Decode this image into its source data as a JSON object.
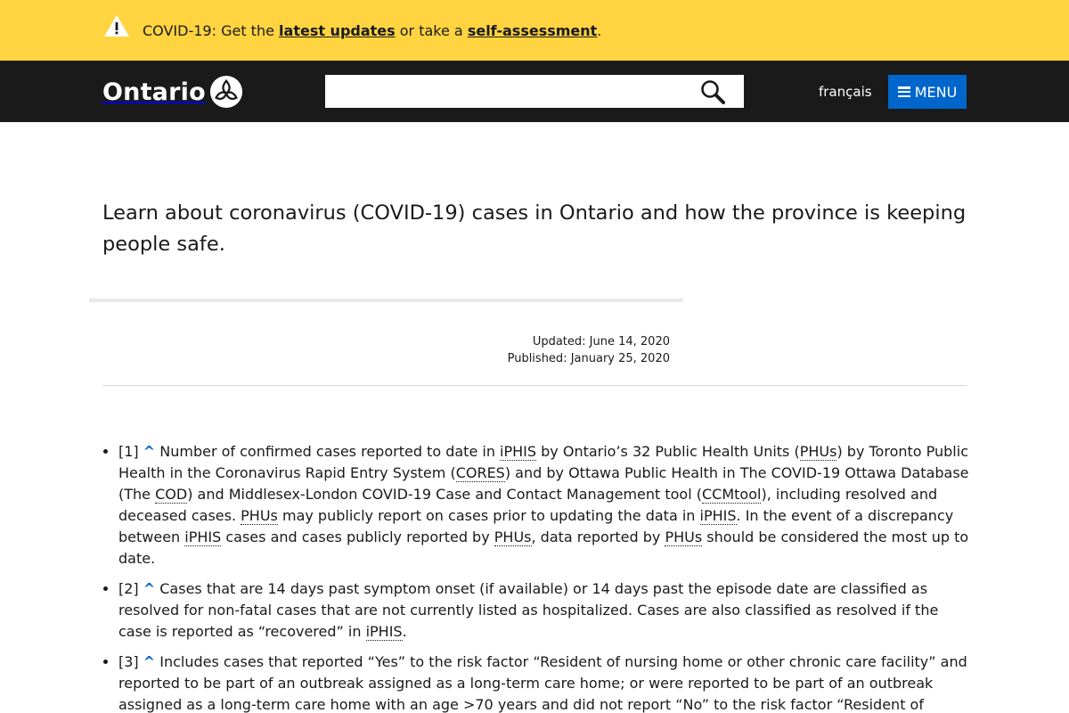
{
  "alert": {
    "icon": "warning-triangle-icon",
    "prefix": "COVID-19: Get the ",
    "link1": "latest updates",
    "middle": " or take a ",
    "link2": "self-assessment",
    "suffix": "."
  },
  "header": {
    "logo_text": "Ontario",
    "logo_icon": "trillium-icon",
    "search_placeholder": "",
    "search_icon": "magnifier-icon",
    "language_link": "français",
    "menu_label": "MENU",
    "menu_icon": "hamburger-icon"
  },
  "main": {
    "lead": "Learn about coronavirus (COVID-19) cases in Ontario and how the province is keeping people safe.",
    "updated": "Updated: June 14, 2020",
    "published": "Published: January 25, 2020"
  },
  "footnotes": {
    "caret": "^",
    "items": [
      {
        "ref": "[1]",
        "t1": " Number of confirmed cases reported to date in ",
        "a1": "iPHIS",
        "t2": " by Ontario’s 32 Public Health Units (",
        "a2": "PHUs",
        "t3": ") by Toronto Public Health in the Coronavirus Rapid Entry System (",
        "a3": "CORES",
        "t4": ") and by Ottawa Public Health in The COVID-19 Ottawa Database (The ",
        "a4": "COD",
        "t5": ") and Middlesex-London COVID-19 Case and Contact Management tool (",
        "a5": "CCMtool",
        "t6": "), including resolved and deceased cases. ",
        "a6": "PHUs",
        "t7": " may publicly report on cases prior to updating the data in ",
        "a7": "iPHIS",
        "t8": ". In the event of a discrepancy between ",
        "a8": "iPHIS",
        "t9": " cases and cases publicly reported by ",
        "a9": "PHUs",
        "t10": ", data reported by ",
        "a10": "PHUs",
        "t11": " should be considered the most up to date."
      },
      {
        "ref": "[2]",
        "t1": " Cases that are 14 days past symptom onset (if available) or 14 days past the episode date are classified as resolved for non-fatal cases that are not currently listed as hospitalized. Cases are also classified as resolved if the case is reported as “recovered” in ",
        "a1": "iPHIS",
        "t2": "."
      },
      {
        "ref": "[3]",
        "t1": " Includes cases that reported “Yes” to the risk factor “Resident of nursing home or other chronic care facility” and reported to be part of an outbreak assigned as a long-term care home; or were reported to be part of an outbreak assigned as a long-term care home with an age >70 years and did not report “No” to the risk factor “Resident of nursing home or other chronic care facility”"
      }
    ]
  },
  "colors": {
    "alert_bg": "#ffd440",
    "header_bg": "#1a1a1a",
    "menu_bg": "#0066cc",
    "link_caret": "#0066cc"
  }
}
